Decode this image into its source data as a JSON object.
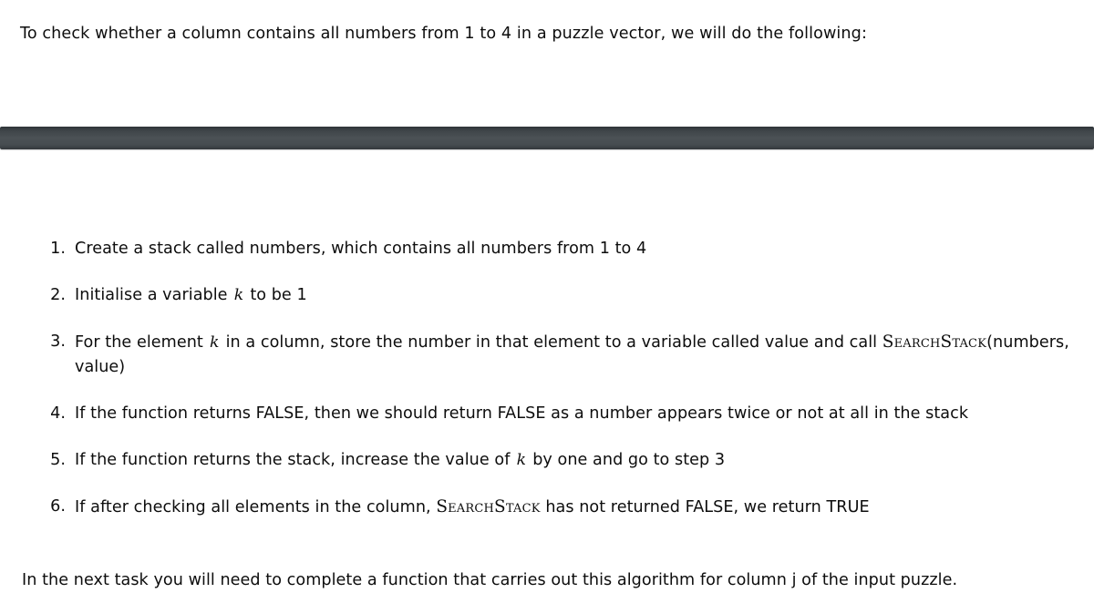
{
  "document": {
    "intro": "To check whether a column contains all numbers from 1 to 4 in a puzzle vector, we will do the following:",
    "separator": {
      "name": "dark-divider-bar",
      "color_top": "#2f3438",
      "color_mid": "#4b5155",
      "color_bottom": "#33383c"
    },
    "steps": [
      {
        "marker": "1.",
        "parts": [
          {
            "type": "text",
            "value": "Create a stack called numbers, which contains all numbers from 1 to 4"
          }
        ]
      },
      {
        "marker": "2.",
        "parts": [
          {
            "type": "text",
            "value": "Initialise a variable "
          },
          {
            "type": "math",
            "value": "k"
          },
          {
            "type": "text",
            "value": " to be 1"
          }
        ]
      },
      {
        "marker": "3.",
        "parts": [
          {
            "type": "text",
            "value": "For the element "
          },
          {
            "type": "math",
            "value": "k"
          },
          {
            "type": "text",
            "value": " in a column, store the number in that element to a variable called value and call "
          },
          {
            "type": "smallcaps",
            "value": "SearchStack"
          },
          {
            "type": "text",
            "value": "(numbers, value)"
          }
        ]
      },
      {
        "marker": "4.",
        "parts": [
          {
            "type": "text",
            "value": "If the function returns FALSE, then we should return FALSE as a number appears twice or not at all in the stack"
          }
        ]
      },
      {
        "marker": "5.",
        "parts": [
          {
            "type": "text",
            "value": "If the function returns the stack, increase the value of "
          },
          {
            "type": "math",
            "value": "k"
          },
          {
            "type": "text",
            "value": " by one and go to step 3"
          }
        ]
      },
      {
        "marker": "6.",
        "parts": [
          {
            "type": "text",
            "value": "If after checking all elements in the column, "
          },
          {
            "type": "smallcaps",
            "value": "SearchStack"
          },
          {
            "type": "text",
            "value": " has not returned FALSE, we return TRUE"
          }
        ]
      }
    ],
    "closing": "In the next task you will need to complete a function that carries out this algorithm for column j of the input puzzle."
  }
}
